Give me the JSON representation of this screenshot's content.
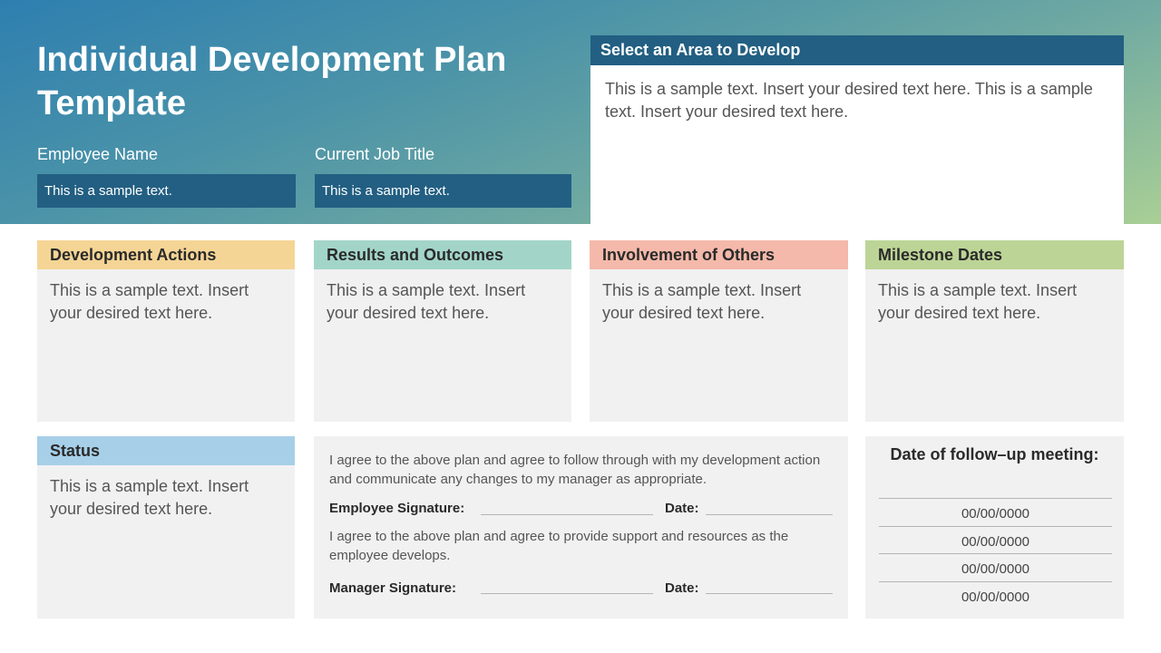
{
  "title": "Individual Development Plan Template",
  "employee": {
    "label": "Employee Name",
    "value": "This is a sample text."
  },
  "job": {
    "label": "Current Job Title",
    "value": "This is a sample text."
  },
  "area": {
    "heading": "Select an Area to Develop",
    "text": "This is a sample text. Insert your desired text here. This is a sample text. Insert your desired text here."
  },
  "cards": [
    {
      "heading": "Development Actions",
      "text": "This is a sample text. Insert your desired text here.",
      "color": "#f5d595"
    },
    {
      "heading": "Results and Outcomes",
      "text": "This is a sample text. Insert your desired text here.",
      "color": "#a2d5c8"
    },
    {
      "heading": "Involvement of Others",
      "text": "This is a sample text. Insert your desired text here.",
      "color": "#f4b9aa"
    },
    {
      "heading": "Milestone Dates",
      "text": "This is a sample text. Insert your desired text here.",
      "color": "#bcd496"
    }
  ],
  "status": {
    "heading": "Status",
    "text": "This is a sample text. Insert your desired text here.",
    "color": "#a7cfe8"
  },
  "agreement": {
    "employee_text": "I agree to the above plan and agree to follow through with my development action and communicate any changes to my manager as appropriate.",
    "employee_sig_label": "Employee Signature:",
    "date_label_1": "Date:",
    "manager_text": "I agree to the above plan and agree to provide support and resources as the employee develops.",
    "manager_sig_label": "Manager Signature:",
    "date_label_2": "Date:"
  },
  "followup": {
    "title": "Date of follow–up meeting:",
    "dates": [
      "00/00/0000",
      "00/00/0000",
      "00/00/0000",
      "00/00/0000"
    ]
  },
  "colors": {
    "header_dark": "#225f82",
    "gradient_start": "#2e7fb0",
    "gradient_end": "#a9cf95",
    "panel_bg": "#f1f1f1"
  }
}
